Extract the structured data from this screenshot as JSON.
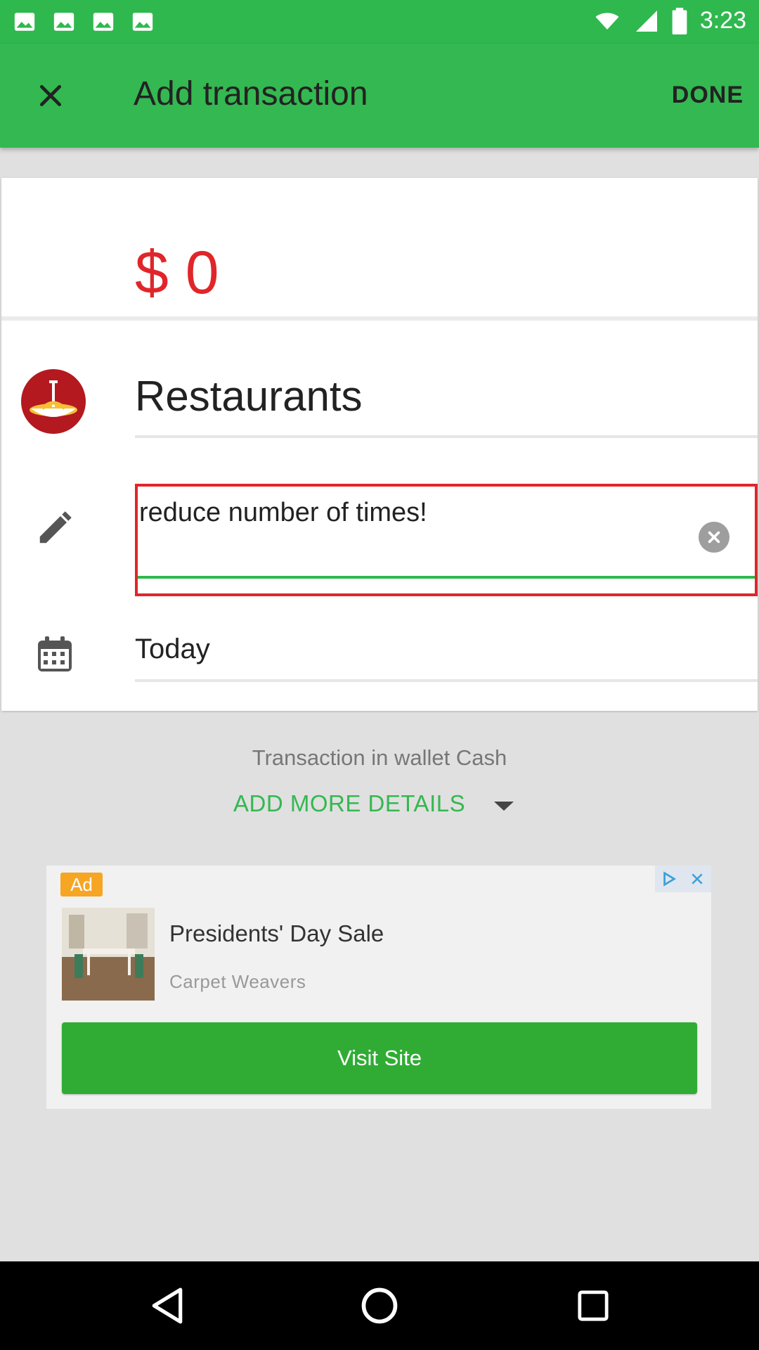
{
  "status_bar": {
    "time": "3:23",
    "icons": [
      "gallery-icon",
      "gallery-icon",
      "gallery-icon",
      "gallery-icon",
      "wifi-icon",
      "signal-icon",
      "battery-icon"
    ]
  },
  "app_bar": {
    "title": "Add transaction",
    "done_label": "DONE",
    "close_icon": "close-icon",
    "background": "#34b851"
  },
  "transaction": {
    "amount": "$ 0",
    "amount_color": "#e0262a",
    "category": "Restaurants",
    "category_icon": "noodle-bowl-icon",
    "note": "reduce number of times!",
    "date": "Today"
  },
  "wallet_text": "Transaction in wallet Cash",
  "add_more_details": "ADD MORE DETAILS",
  "ad": {
    "badge": "Ad",
    "title": "Presidents' Day Sale",
    "advertiser": "Carpet Weavers",
    "cta": "Visit Site",
    "cta_color": "#30ac35"
  },
  "nav": [
    "back-icon",
    "home-icon",
    "recents-icon"
  ]
}
